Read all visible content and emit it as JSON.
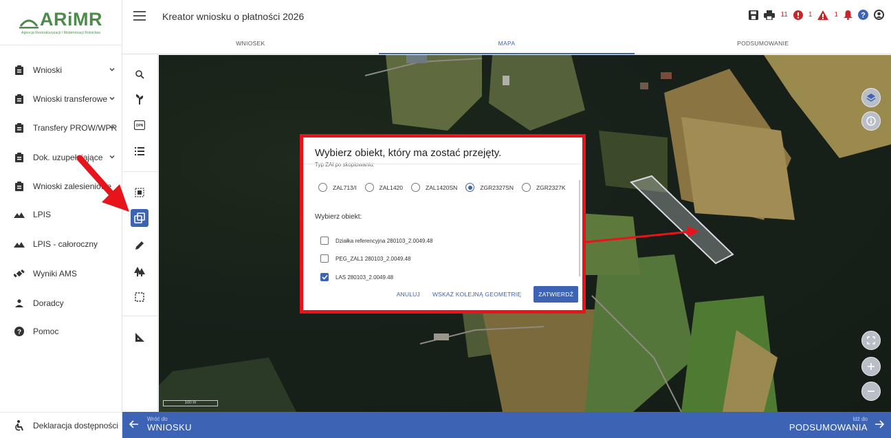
{
  "logo": {
    "text": "ARiMR",
    "subtitle": "Agencja Restrukturyzacji i Modernizacji Rolnictwa"
  },
  "sidebar": {
    "items": [
      {
        "label": "Wnioski",
        "icon": "clipboard-icon",
        "has_chevron": true
      },
      {
        "label": "Wnioski transferowe",
        "icon": "clipboard-icon",
        "has_chevron": true
      },
      {
        "label": "Transfery PROW/WPR",
        "icon": "clipboard-icon",
        "has_chevron": true
      },
      {
        "label": "Dok. uzupełniające",
        "icon": "clipboard-icon",
        "has_chevron": true
      },
      {
        "label": "Wnioski zalesieniowe",
        "icon": "clipboard-icon",
        "has_chevron": false
      },
      {
        "label": "LPIS",
        "icon": "mountain-icon",
        "has_chevron": false
      },
      {
        "label": "LPIS - całoroczny",
        "icon": "mountain-icon",
        "has_chevron": false
      },
      {
        "label": "Wyniki AMS",
        "icon": "satellite-icon",
        "has_chevron": false
      },
      {
        "label": "Doradcy",
        "icon": "person-icon",
        "has_chevron": false
      },
      {
        "label": "Pomoc",
        "icon": "help-icon",
        "has_chevron": false
      }
    ],
    "bottom_link": "Deklaracja dostępności"
  },
  "header": {
    "title": "Kreator wniosku o płatności 2026",
    "error_count": "11",
    "warning_count": "1",
    "notification_count": "1"
  },
  "tabs": [
    {
      "label": "WNIOSEK",
      "active": false
    },
    {
      "label": "MAPA",
      "active": true
    },
    {
      "label": "PODSUMOWANIE",
      "active": false
    }
  ],
  "map": {
    "scale_label": "100 m"
  },
  "dialog": {
    "title": "Wybierz obiekt, który ma zostać przejęty.",
    "type_label": "Typ ZAł po skopiowaniu:",
    "radios": [
      {
        "label": "ZAL713/I",
        "checked": false
      },
      {
        "label": "ZAL1420",
        "checked": false
      },
      {
        "label": "ZAL1420SN",
        "checked": false
      },
      {
        "label": "ZGR2327SN",
        "checked": true
      },
      {
        "label": "ZGR2327K",
        "checked": false
      }
    ],
    "select_label": "Wybierz obiekt:",
    "objects": [
      {
        "label": "Działka referencyjna 280103_2.0049.48",
        "checked": false
      },
      {
        "label": "PEG_ZAL1 280103_2.0049.48",
        "checked": false
      },
      {
        "label": "LAS 280103_2.0049.48",
        "checked": true
      }
    ],
    "cancel_label": "ANULUJ",
    "next_geometry_label": "WSKAŻ KOLEJNĄ GEOMETRIĘ",
    "confirm_label": "ZATWIERDŹ"
  },
  "footer": {
    "back_small": "Wróć do",
    "back_big": "WNIOSKU",
    "next_small": "Idź do",
    "next_big": "PODSUMOWANIA"
  },
  "colors": {
    "primary": "#3d63b5",
    "highlight": "#e8141c",
    "logo_green": "#4d8b4d"
  }
}
